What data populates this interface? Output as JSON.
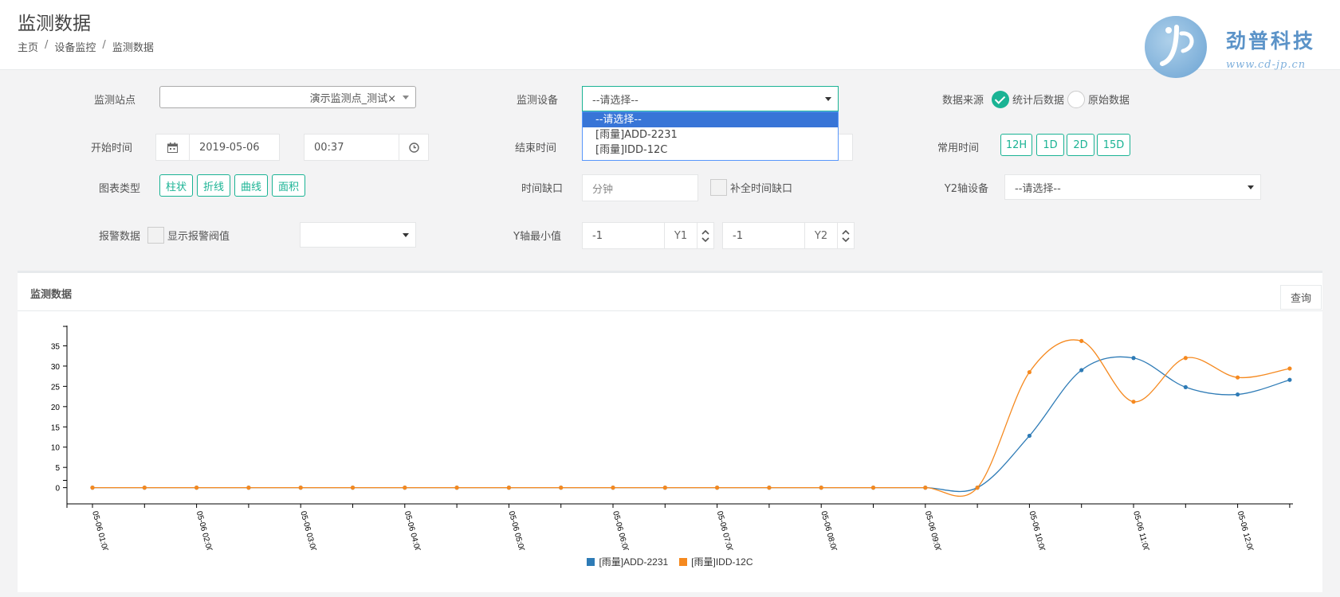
{
  "header": {
    "title": "监测数据",
    "breadcrumb": [
      "主页",
      "设备监控",
      "监测数据"
    ]
  },
  "logo": {
    "name": "劲普科技",
    "url": "www.cd-jp.cn"
  },
  "form": {
    "station_label": "监测站点",
    "station_value": "演示监测点_测试×",
    "device_label": "监测设备",
    "device_value": "--请选择--",
    "device_options": [
      "--请选择--",
      "[雨量]ADD-2231",
      "[雨量]IDD-12C"
    ],
    "source_label": "数据来源",
    "source_stat": "统计后数据",
    "source_raw": "原始数据",
    "start_label": "开始时间",
    "start_date": "2019-05-06",
    "start_time": "00:37",
    "end_label": "结束时间",
    "common_time_label": "常用时间",
    "common_times": [
      "12H",
      "1D",
      "2D",
      "15D"
    ],
    "chart_type_label": "图表类型",
    "chart_types": [
      "柱状",
      "折线",
      "曲线",
      "面积"
    ],
    "gap_label": "时间缺口",
    "gap_unit": "分钟",
    "fill_gap": "补全时间缺口",
    "y2_device_label": "Y2轴设备",
    "y2_device_value": "--请选择--",
    "alarm_label": "报警数据",
    "show_alarm": "显示报警阀值",
    "ymin_label": "Y轴最小值",
    "y1_value": "-1",
    "y1_label": "Y1",
    "y2_value": "-1",
    "y2_label": "Y2"
  },
  "panel": {
    "title": "监测数据",
    "query_button": "查询"
  },
  "colors": {
    "accent": "#1ab394",
    "series1": "#2e7bb6",
    "series2": "#f5891f"
  },
  "chart_data": {
    "type": "line",
    "x": [
      "05-06 01:00",
      "05-06 01:30",
      "05-06 02:00",
      "05-06 02:30",
      "05-06 03:00",
      "05-06 03:30",
      "05-06 04:00",
      "05-06 04:30",
      "05-06 05:00",
      "05-06 05:30",
      "05-06 06:00",
      "05-06 06:30",
      "05-06 07:00",
      "05-06 07:30",
      "05-06 08:00",
      "05-06 08:30",
      "05-06 09:00",
      "05-06 09:30",
      "05-06 10:00",
      "05-06 10:30",
      "05-06 11:00",
      "05-06 11:30",
      "05-06 12:00",
      "05-06 12:30"
    ],
    "xticklabels": [
      "05-06 01:00",
      "05-06 02:00",
      "05-06 03:00",
      "05-06 04:00",
      "05-06 05:00",
      "05-06 06:00",
      "05-06 07:00",
      "05-06 08:00",
      "05-06 09:00",
      "05-06 10:00",
      "05-06 11:00",
      "05-06 12:00"
    ],
    "series": [
      {
        "name": "[雨量]ADD-2231",
        "values": [
          0,
          0,
          0,
          0,
          0,
          0,
          0,
          0,
          0,
          0,
          0,
          0,
          0,
          0,
          0,
          0,
          0,
          0,
          12.8,
          29,
          32,
          24.8,
          23,
          26.6
        ]
      },
      {
        "name": "[雨量]IDD-12C",
        "values": [
          0,
          0,
          0,
          0,
          0,
          0,
          0,
          0,
          0,
          0,
          0,
          0,
          0,
          0,
          0,
          0,
          0,
          0,
          28.5,
          36.2,
          21.2,
          32,
          27.2,
          29.4
        ]
      }
    ],
    "yticks": [
      0,
      5,
      10,
      15,
      20,
      25,
      30,
      35
    ],
    "ylim": [
      -4,
      40
    ],
    "curve": "smooth",
    "legend_position": "bottom"
  }
}
